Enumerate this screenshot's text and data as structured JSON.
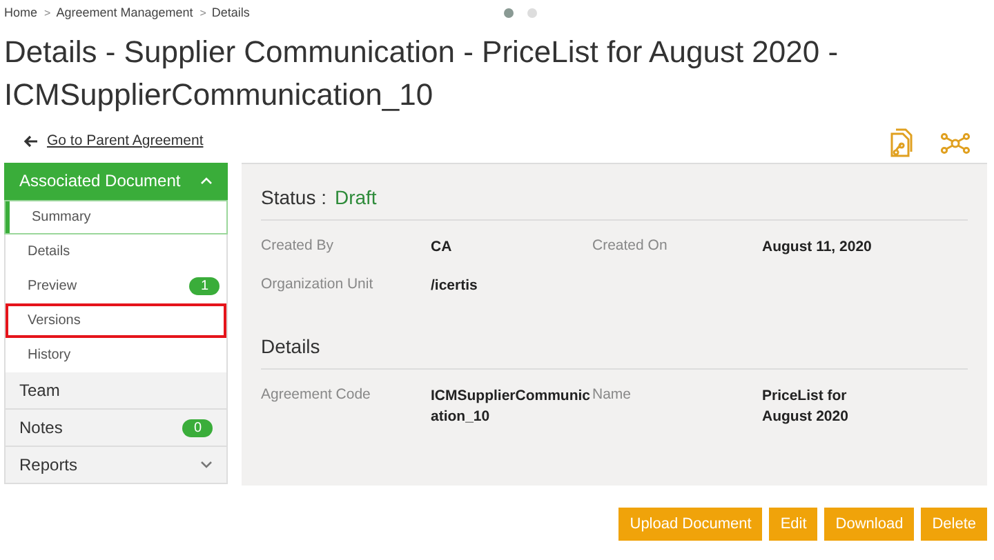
{
  "breadcrumb": [
    {
      "kind": "link",
      "text": "Home"
    },
    {
      "kind": "separator",
      "text": ">"
    },
    {
      "kind": "link",
      "text": "Agreement Management"
    },
    {
      "kind": "separator",
      "text": ">"
    },
    {
      "kind": "link",
      "text": "Details"
    }
  ],
  "pager": [
    {
      "selected": true
    },
    {
      "selected": false
    }
  ],
  "title": "Details - Supplier Communication - PriceList for August 2020 - ICMSupplierCommunication_10",
  "back_link": "Go to Parent Agreement",
  "sidebar": [
    {
      "label": "Associated Document",
      "expanded": true,
      "children": [
        {
          "label": "Summary",
          "selected": true,
          "highlighted": false
        },
        {
          "label": "Details",
          "selected": false,
          "highlighted": false
        },
        {
          "label": "Preview",
          "selected": false,
          "highlighted": false,
          "badge": "1"
        },
        {
          "label": "Versions",
          "selected": false,
          "highlighted": true
        },
        {
          "label": "History",
          "selected": false,
          "highlighted": false
        }
      ]
    },
    {
      "label": "Team"
    },
    {
      "label": "Notes",
      "badge": "0"
    },
    {
      "label": "Reports",
      "expanded": false
    }
  ],
  "status": {
    "label": "Status :",
    "value": "Draft"
  },
  "fields": [
    {
      "label": "Created By",
      "value": "CA"
    },
    {
      "label": "Created On",
      "value": "August 11, 2020"
    },
    {
      "label": "Organization Unit",
      "value": "/icertis"
    }
  ],
  "details": {
    "title": "Details",
    "fields": [
      {
        "label": "Agreement Code",
        "value": "ICMSupplierCommunication_10"
      },
      {
        "label": "Name",
        "value": "PriceList for August 2020"
      }
    ]
  },
  "buttons": [
    "Upload Document",
    "Edit",
    "Download",
    "Delete"
  ]
}
